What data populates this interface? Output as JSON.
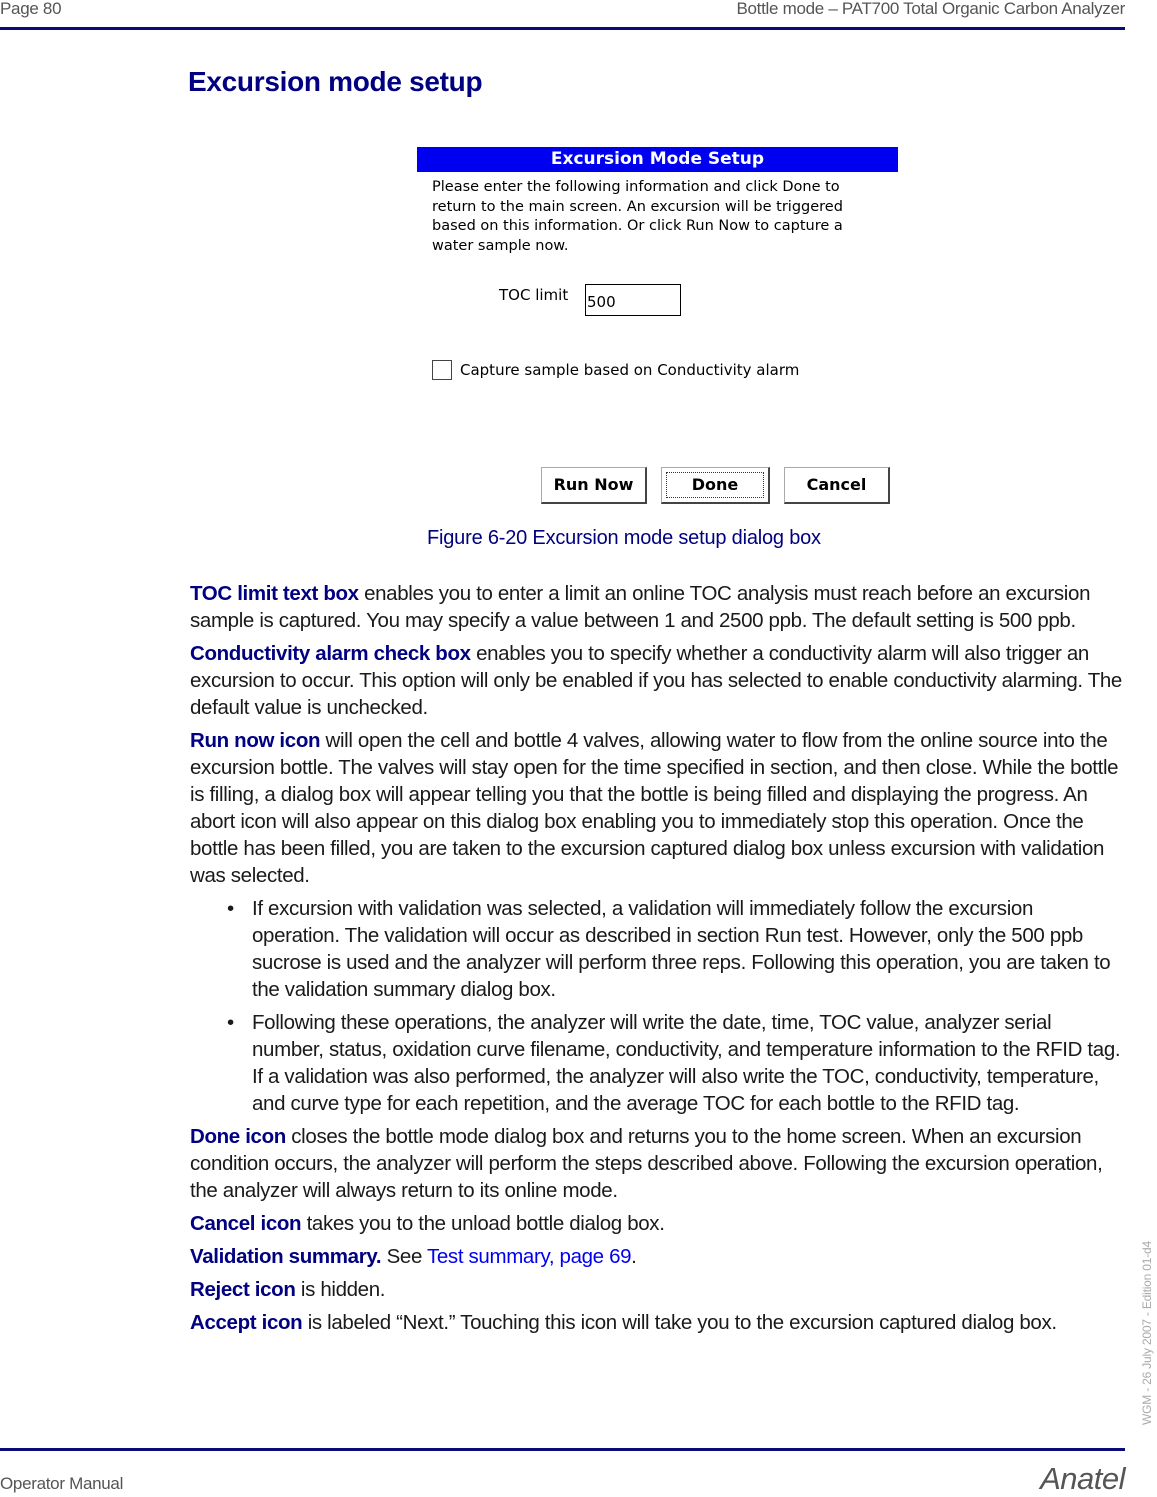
{
  "header": {
    "page_label": "Page 80",
    "section_title": "Bottle mode – PAT700 Total Organic Carbon Analyzer"
  },
  "page_title": "Excursion mode setup",
  "dialog": {
    "title": "Excursion Mode Setup",
    "message": "Please enter the following information and click Done to return to the main screen. An excursion will be triggered based on this information. Or click Run Now to capture a water sample now.",
    "toc_limit_label": "TOC limit",
    "toc_limit_value": "500",
    "checkbox_label": "Capture sample based on Conductivity alarm",
    "checkbox_checked": false,
    "buttons": {
      "run_now": "Run Now",
      "done": "Done",
      "cancel": "Cancel"
    },
    "colors": {
      "titlebar": "#0000f0"
    }
  },
  "figure_caption": "Figure 6-20 Excursion mode setup dialog box",
  "body": {
    "toc_limit": {
      "term": "TOC limit text box",
      "text": " enables you to enter a limit an online TOC analysis must reach before an excursion sample is captured. You may specify a value between 1 and 2500 ppb. The default setting is 500 ppb."
    },
    "conductivity": {
      "term": "Conductivity alarm check box",
      "text": " enables you to specify whether a conductivity alarm will also trigger an excursion to occur. This option will only be enabled if you has selected to enable conductivity alarming. The default value is unchecked."
    },
    "run_now": {
      "term": "Run now icon",
      "text": " will open the cell and bottle 4 valves, allowing water to flow from the online source into the excursion bottle. The valves will stay open for the time specified in section, and then close. While the bottle is filling, a dialog box will appear telling you that the bottle is being filled and displaying the progress. An abort icon will also appear on this dialog box enabling you to immediately stop this operation. Once the bottle has been filled, you are taken to the excursion captured dialog box unless excursion with validation was selected."
    },
    "bullets": [
      "If excursion with validation was selected, a validation will immediately follow the excursion operation. The validation will occur as described in section Run test. However, only the 500 ppb sucrose is used and the analyzer will perform three reps. Following this operation, you are taken to the validation summary dialog box.",
      "Following these operations, the analyzer will write the date, time, TOC value, analyzer serial number, status, oxidation curve filename, conductivity, and temperature information to the RFID tag. If a validation was also performed, the analyzer will also write the TOC, conductivity, temperature, and curve type for each repetition, and the average TOC for each bottle to the RFID tag."
    ],
    "bullet_glyph": "•",
    "done": {
      "term": "Done icon",
      "text": " closes the bottle mode dialog box and returns you to the home screen. When an excursion condition occurs, the analyzer will perform the steps described above. Following the excursion operation, the analyzer will always return to its online mode."
    },
    "cancel": {
      "term": "Cancel icon",
      "text": " takes you to the unload bottle dialog box."
    },
    "validation": {
      "term": "Validation summary.",
      "pre": " See ",
      "link": "Test summary, page 69",
      "post": "."
    },
    "reject": {
      "term": "Reject icon",
      "text": " is hidden."
    },
    "accept": {
      "term": "Accept icon",
      "text": " is labeled “Next.” Touching this icon will take you to the excursion captured dialog box."
    }
  },
  "side_note": "WGM - 26 July 2007 - Edition 01-d4",
  "footer": {
    "left": "Operator Manual",
    "right": "Anatel"
  }
}
